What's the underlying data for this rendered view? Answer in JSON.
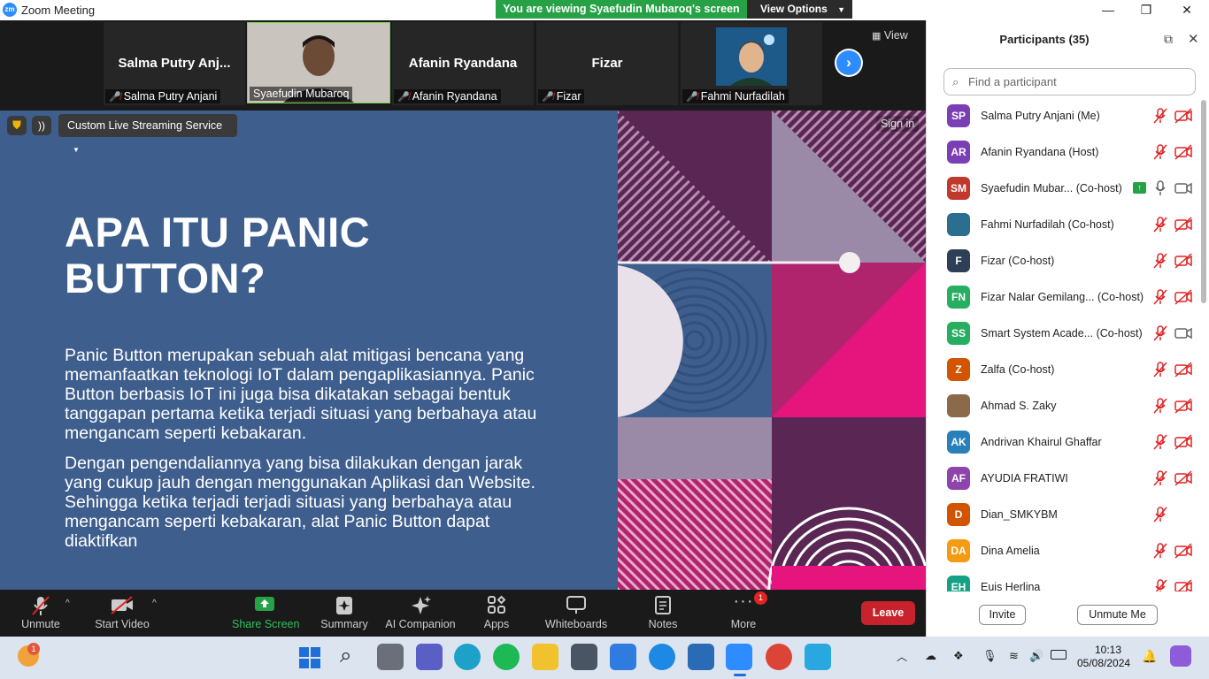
{
  "window": {
    "app_icon": "zm",
    "title": "Zoom Meeting"
  },
  "share_banner": {
    "message": "You are viewing Syaefudin Mubaroq's screen",
    "view_options": "View Options"
  },
  "video_strip": {
    "view_label": "View",
    "tiles": [
      {
        "display_name": "Salma  Putry  Anj...",
        "label": "Salma Putry Anjani",
        "muted": true
      },
      {
        "display_name": "",
        "label": "Syaefudin Mubaroq",
        "muted": false
      },
      {
        "display_name": "Afanin Ryandana",
        "label": "Afanin Ryandana",
        "muted": true
      },
      {
        "display_name": "Fizar",
        "label": "Fizar",
        "muted": true
      },
      {
        "display_name": "",
        "label": "Fahmi Nurfadilah",
        "muted": true
      }
    ]
  },
  "share_toolbar": {
    "stream_service": "Custom Live Streaming Service",
    "sign_in": "Sign in"
  },
  "slide": {
    "title": "APA ITU PANIC BUTTON?",
    "paragraph1": "Panic Button merupakan sebuah alat mitigasi bencana yang memanfaatkan teknologi IoT dalam pengaplikasiannya. Panic Button berbasis IoT  ini juga bisa dikatakan sebagai bentuk tanggapan pertama ketika terjadi situasi yang berbahaya atau mengancam seperti kebakaran.",
    "paragraph2": "Dengan pengendaliannya yang bisa dilakukan dengan jarak yang cukup jauh dengan menggunakan Aplikasi dan Website. Sehingga ketika terjadi terjadi situasi yang berbahaya atau mengancam seperti kebakaran, alat Panic Button dapat diaktifkan"
  },
  "participants_panel": {
    "title": "Participants (35)",
    "search_placeholder": "Find a participant",
    "invite": "Invite",
    "unmute_me": "Unmute Me",
    "participants": [
      {
        "initials": "SP",
        "name": "Salma Putry Anjani (Me)",
        "color": "#7b3fb5",
        "mic": "off",
        "cam": "off"
      },
      {
        "initials": "AR",
        "name": "Afanin Ryandana (Host)",
        "color": "#7b3fb5",
        "mic": "off",
        "cam": "off"
      },
      {
        "initials": "SM",
        "name": "Syaefudin Mubar...  (Co-host)",
        "color": "#c0392b",
        "mic": "on",
        "cam": "on",
        "sharing": true
      },
      {
        "initials": "",
        "name": "Fahmi Nurfadilah (Co-host)",
        "color": "#2c6e8f",
        "mic": "off",
        "cam": "off"
      },
      {
        "initials": "F",
        "name": "Fizar (Co-host)",
        "color": "#2e4057",
        "mic": "off",
        "cam": "off"
      },
      {
        "initials": "FN",
        "name": "Fizar Nalar Gemilang...  (Co-host)",
        "color": "#27ae60",
        "mic": "off",
        "cam": "off"
      },
      {
        "initials": "SS",
        "name": "Smart System Acade...  (Co-host)",
        "color": "#27ae60",
        "mic": "off",
        "cam": "on"
      },
      {
        "initials": "Z",
        "name": "Zalfa (Co-host)",
        "color": "#d35400",
        "mic": "off",
        "cam": "off"
      },
      {
        "initials": "",
        "name": "Ahmad S. Zaky",
        "color": "#8a6a4a",
        "mic": "off",
        "cam": "off"
      },
      {
        "initials": "AK",
        "name": "Andrivan Khairul Ghaffar",
        "color": "#2980b9",
        "mic": "off",
        "cam": "off"
      },
      {
        "initials": "AF",
        "name": "AYUDIA FRATIWI",
        "color": "#8e44ad",
        "mic": "off",
        "cam": "off"
      },
      {
        "initials": "D",
        "name": "Dian_SMKYBM",
        "color": "#d35400",
        "mic": "off",
        "cam": "none"
      },
      {
        "initials": "DA",
        "name": "Dina Amelia",
        "color": "#f39c12",
        "mic": "off",
        "cam": "off"
      },
      {
        "initials": "EH",
        "name": "Euis Herlina",
        "color": "#16a085",
        "mic": "off",
        "cam": "off"
      }
    ]
  },
  "toolbar": {
    "items": [
      {
        "icon": "mic-muted-icon",
        "label": "Unmute"
      },
      {
        "icon": "video-off-icon",
        "label": "Start Video"
      },
      {
        "icon": "share-screen-icon",
        "label": "Share Screen"
      },
      {
        "icon": "summary-icon",
        "label": "Summary"
      },
      {
        "icon": "ai-companion-icon",
        "label": "AI Companion"
      },
      {
        "icon": "apps-icon",
        "label": "Apps"
      },
      {
        "icon": "whiteboards-icon",
        "label": "Whiteboards"
      },
      {
        "icon": "notes-icon",
        "label": "Notes"
      },
      {
        "icon": "more-icon",
        "label": "More",
        "badge": "1"
      }
    ],
    "leave": "Leave"
  },
  "taskbar": {
    "weather_badge": "1",
    "clock_time": "10:13",
    "clock_date": "05/08/2024",
    "colors": {
      "accent_blue": "#2d8cff",
      "banner_green": "#26a146",
      "leave_red": "#c8232c",
      "slide_blue": "#3e5e8d"
    }
  }
}
